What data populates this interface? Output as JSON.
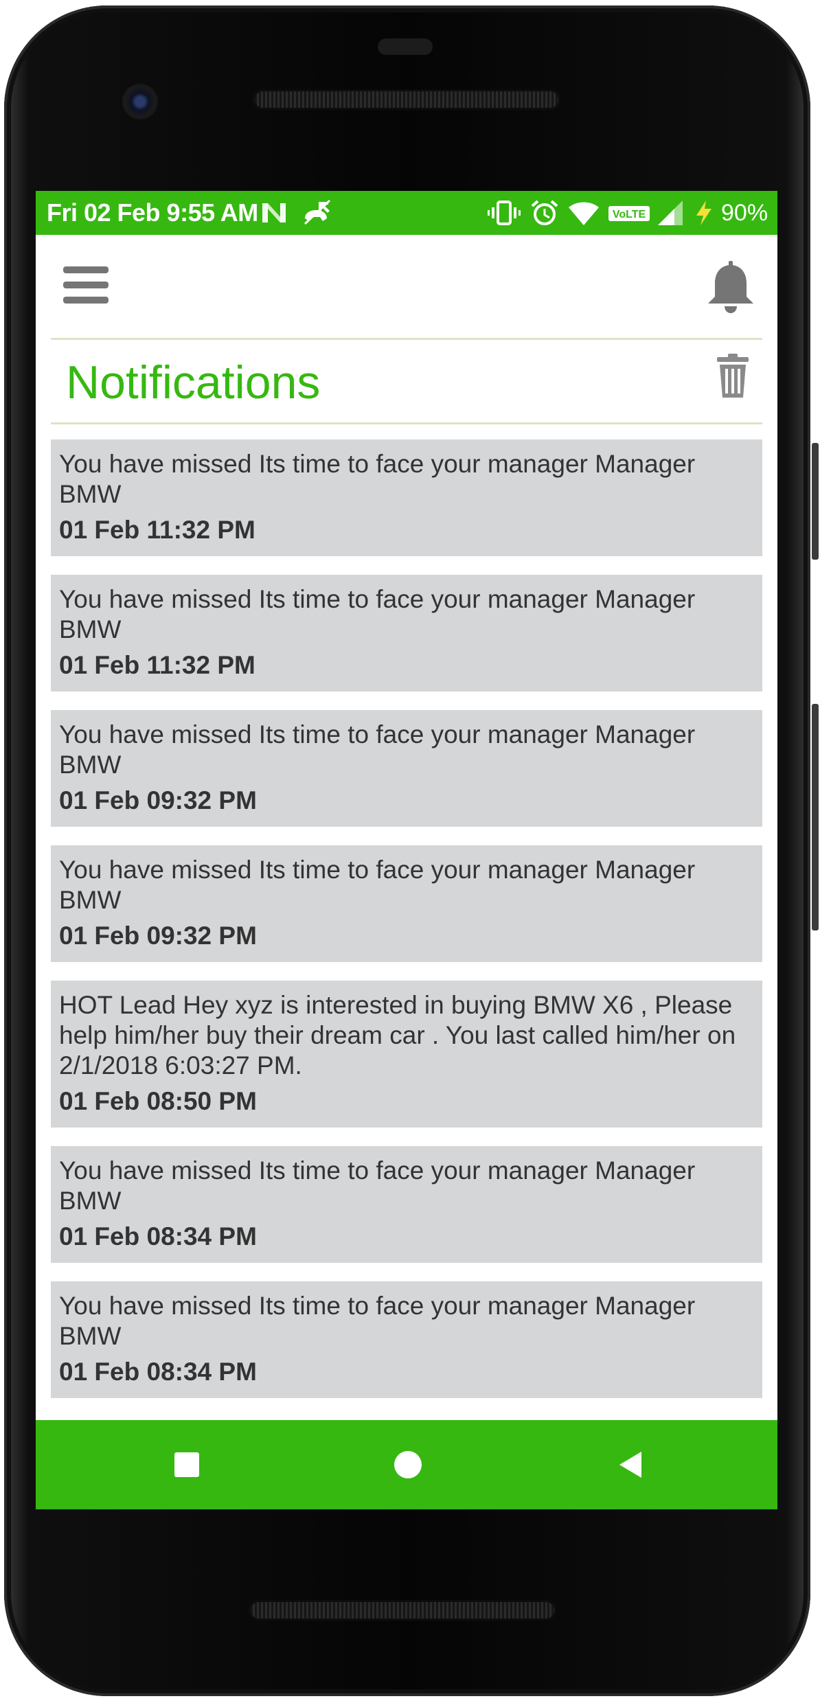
{
  "status_bar": {
    "time": "Fri 02 Feb 9:55 AM",
    "battery": "90%",
    "background_color": "#36b811",
    "icons": [
      "n-notification-icon",
      "missed-call-icon",
      "vibrate-icon",
      "alarm-icon",
      "wifi-icon",
      "volte-icon",
      "signal-icon",
      "charging-icon"
    ],
    "volte_label": "VoLTE"
  },
  "app_bar": {
    "menu_icon": "hamburger-menu-icon",
    "bell_icon": "bell-icon"
  },
  "header": {
    "title": "Notifications",
    "title_color": "#36b811",
    "delete_icon": "trash-icon"
  },
  "notifications": [
    {
      "message": "You have missed Its time to face your manager Manager BMW",
      "time": "01 Feb 11:32 PM"
    },
    {
      "message": "You have missed Its time to face your manager Manager BMW",
      "time": "01 Feb 11:32 PM"
    },
    {
      "message": "You have missed Its time to face your manager Manager BMW",
      "time": "01 Feb 09:32 PM"
    },
    {
      "message": "You have missed Its time to face your manager Manager BMW",
      "time": "01 Feb 09:32 PM"
    },
    {
      "message": "HOT Lead Hey xyz is interested in buying BMW X6 , Please help him/her buy their dream car . You last called him/her on 2/1/2018 6:03:27 PM.",
      "time": "01 Feb 08:50 PM"
    },
    {
      "message": "You have missed Its time to face your manager Manager BMW",
      "time": "01 Feb 08:34 PM"
    },
    {
      "message": "You have missed Its time to face your manager Manager BMW",
      "time": "01 Feb 08:34 PM"
    }
  ],
  "nav_bar": {
    "background_color": "#36b811",
    "buttons": [
      "recents-square-icon",
      "home-circle-icon",
      "back-triangle-icon"
    ]
  }
}
